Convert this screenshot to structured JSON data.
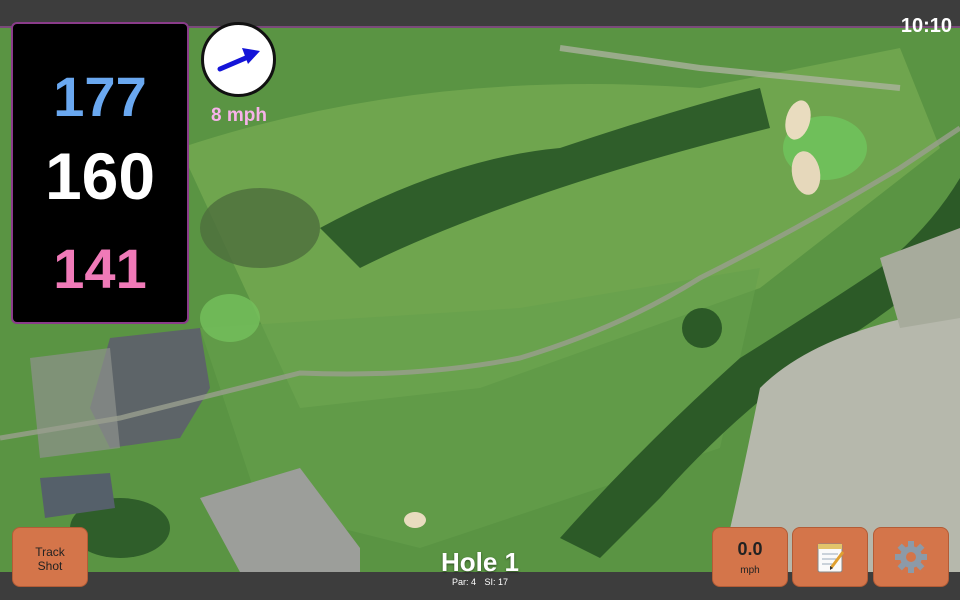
{
  "status_bar": {
    "time": "10:10"
  },
  "distances": {
    "back": "177",
    "middle": "160",
    "front": "141"
  },
  "wind": {
    "speed_label": "8 mph",
    "direction_icon": "arrow-right-icon"
  },
  "hole": {
    "title": "Hole 1",
    "par_label": "Par: 4",
    "si_label": "SI: 17"
  },
  "buttons": {
    "track_shot": {
      "line1": "Track",
      "line2": "Shot"
    },
    "wind_readout": {
      "value": "0.0",
      "unit": "mph"
    },
    "scorecard": {
      "icon": "notepad-icon"
    },
    "settings": {
      "icon": "gear-icon"
    }
  },
  "colors": {
    "back_distance": "#6aa8f0",
    "middle_distance": "#ffffff",
    "front_distance": "#f07ab8",
    "button_bg": "#d4754a",
    "wind_label": "#f7b2ea"
  }
}
